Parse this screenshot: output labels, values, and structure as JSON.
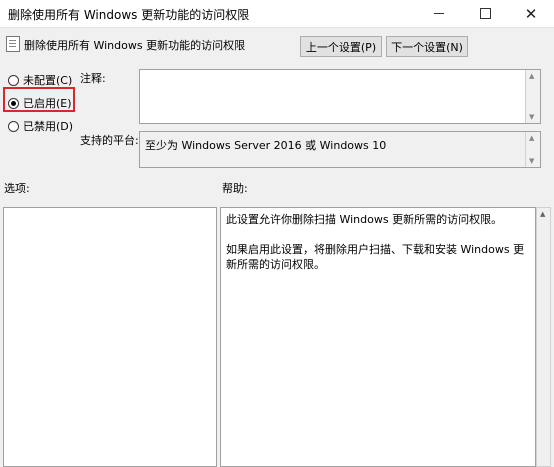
{
  "window": {
    "title": "删除使用所有 Windows 更新功能的访问权限",
    "minimize_glyph": "",
    "maximize_glyph": "",
    "close_glyph": "✕"
  },
  "header": {
    "policy_name": "删除使用所有 Windows 更新功能的访问权限",
    "prev_button": "上一个设置(P)",
    "next_button": "下一个设置(N)"
  },
  "state_options": {
    "not_configured": "未配置(C)",
    "enabled": "已启用(E)",
    "disabled": "已禁用(D)",
    "selected": "enabled"
  },
  "fields": {
    "comment_label": "注释:",
    "comment_value": "",
    "platform_label": "支持的平台:",
    "platform_value": "至少为 Windows Server 2016 或 Windows 10"
  },
  "panes": {
    "options_label": "选项:",
    "help_label": "帮助:",
    "help_paragraphs": [
      "此设置允许你删除扫描 Windows 更新所需的访问权限。",
      "如果启用此设置，将删除用户扫描、下载和安装 Windows 更新所需的访问权限。"
    ]
  },
  "colors": {
    "highlight_border": "#d42a2a",
    "window_bg": "#f0f0f0"
  }
}
